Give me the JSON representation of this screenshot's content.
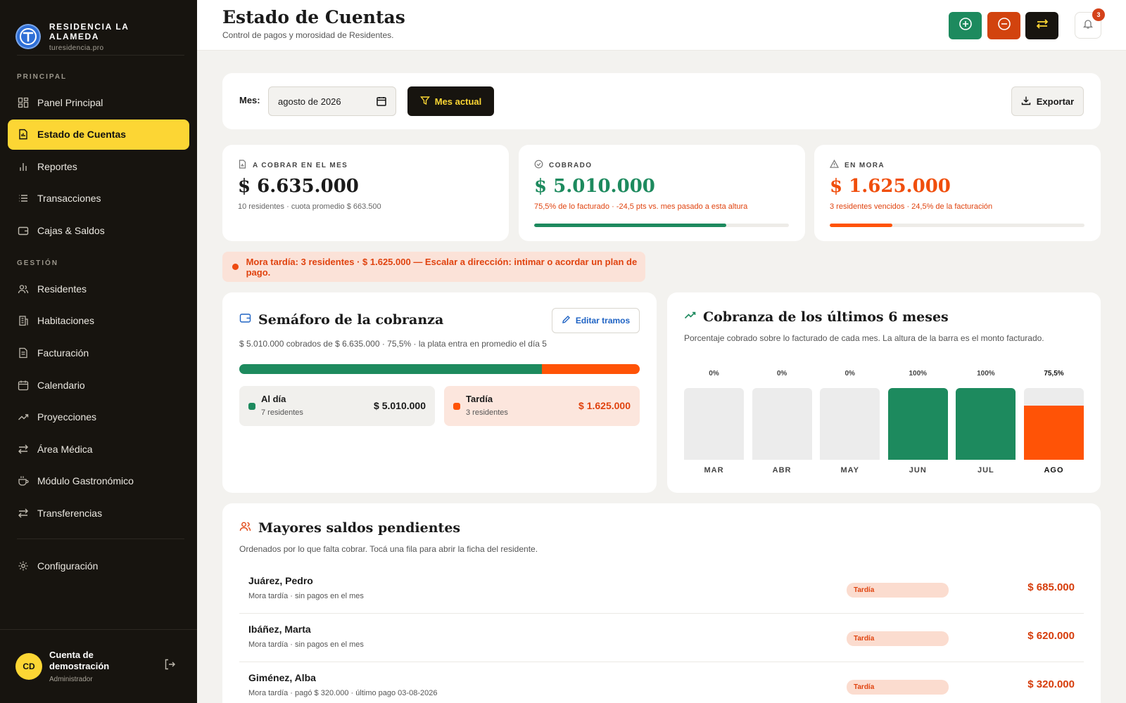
{
  "brand": {
    "name": "RESIDENCIA LA ALAMEDA",
    "domain": "turesidencia.pro"
  },
  "sidebar": {
    "section_principal": "PRINCIPAL",
    "section_gestion": "GESTIÓN",
    "items": [
      {
        "label": "Panel Principal",
        "icon": "grid-icon"
      },
      {
        "label": "Estado de Cuentas",
        "icon": "document-icon"
      },
      {
        "label": "Reportes",
        "icon": "bar-chart-icon"
      },
      {
        "label": "Transacciones",
        "icon": "list-icon"
      },
      {
        "label": "Cajas & Saldos",
        "icon": "wallet-icon"
      },
      {
        "label": "Residentes",
        "icon": "users-icon"
      },
      {
        "label": "Habitaciones",
        "icon": "building-icon"
      },
      {
        "label": "Facturación",
        "icon": "invoice-icon"
      },
      {
        "label": "Calendario",
        "icon": "calendar-icon"
      },
      {
        "label": "Proyecciones",
        "icon": "trend-icon"
      },
      {
        "label": "Área Médica",
        "icon": "transfer-icon"
      },
      {
        "label": "Módulo Gastronómico",
        "icon": "cup-icon"
      },
      {
        "label": "Transferencias",
        "icon": "transfer-icon"
      },
      {
        "label": "Configuración",
        "icon": "gear-icon"
      }
    ]
  },
  "user": {
    "initials": "CD",
    "name": "Cuenta de demostración",
    "role": "Administrador"
  },
  "header": {
    "title": "Estado de Cuentas",
    "subtitle": "Control de pagos y morosidad de Residentes.",
    "notifications": "3"
  },
  "filter": {
    "month_label": "Mes:",
    "month_value": "agosto de 2026",
    "current_month_btn": "Mes actual",
    "export_btn": "Exportar"
  },
  "stats": [
    {
      "label": "A COBRAR EN EL MES",
      "value": "$ 6.635.000",
      "note": "10 residentes · cuota promedio $ 663.500",
      "color": "#111111",
      "progress": null
    },
    {
      "label": "COBRADO",
      "value": "$ 5.010.000",
      "note": "75,5% de lo facturado · -24,5 pts vs. mes pasado a esta altura",
      "color": "#1d8a5e",
      "progress": 0.755
    },
    {
      "label": "EN MORA",
      "value": "$ 1.625.000",
      "note": "3 residentes vencidos · 24,5% de la facturación",
      "color": "#f04e0c",
      "progress": 0.245
    }
  ],
  "alert": "Mora tardía: 3 residentes · $ 1.625.000 — Escalar a dirección: intimar o acordar un plan de pago.",
  "semaforo": {
    "title": "Semáforo de la cobranza",
    "edit_btn": "Editar tramos",
    "subtitle": "$ 5.010.000 cobrados de $ 6.635.000 · 75,5% · la plata entra en promedio el día 5",
    "split": [
      0.755,
      0.245
    ],
    "tiles": [
      {
        "name": "Al día",
        "sub": "7 residentes",
        "amount": "$ 5.010.000"
      },
      {
        "name": "Tardía",
        "sub": "3 residentes",
        "amount": "$ 1.625.000"
      }
    ]
  },
  "cobranza": {
    "title": "Cobranza de los últimos 6 meses",
    "subtitle": "Porcentaje cobrado sobre lo facturado de cada mes. La altura de la barra es el monto facturado."
  },
  "chart_data": {
    "type": "bar",
    "categories": [
      "MAR",
      "ABR",
      "MAY",
      "JUN",
      "JUL",
      "AGO"
    ],
    "values": [
      0,
      0,
      0,
      100,
      100,
      75.5
    ],
    "labels": [
      "0%",
      "0%",
      "0%",
      "100%",
      "100%",
      "75,5%"
    ],
    "ylim": [
      0,
      100
    ],
    "colors": {
      "paid": "#1d8a5e",
      "current": "#ff5306",
      "track": "#ececec"
    }
  },
  "saldos": {
    "title": "Mayores saldos pendientes",
    "subtitle": "Ordenados por lo que falta cobrar. Tocá una fila para abrir la ficha del residente.",
    "rows": [
      {
        "name": "Juárez, Pedro",
        "detail": "Mora tardía · sin pagos en el mes",
        "badge": "Tardía",
        "amount": "$ 685.000"
      },
      {
        "name": "Ibáñez, Marta",
        "detail": "Mora tardía · sin pagos en el mes",
        "badge": "Tardía",
        "amount": "$ 620.000"
      },
      {
        "name": "Giménez, Alba",
        "detail": "Mora tardía · pagó $ 320.000 · último pago 03-08-2026",
        "badge": "Tardía",
        "amount": "$ 320.000"
      }
    ]
  }
}
